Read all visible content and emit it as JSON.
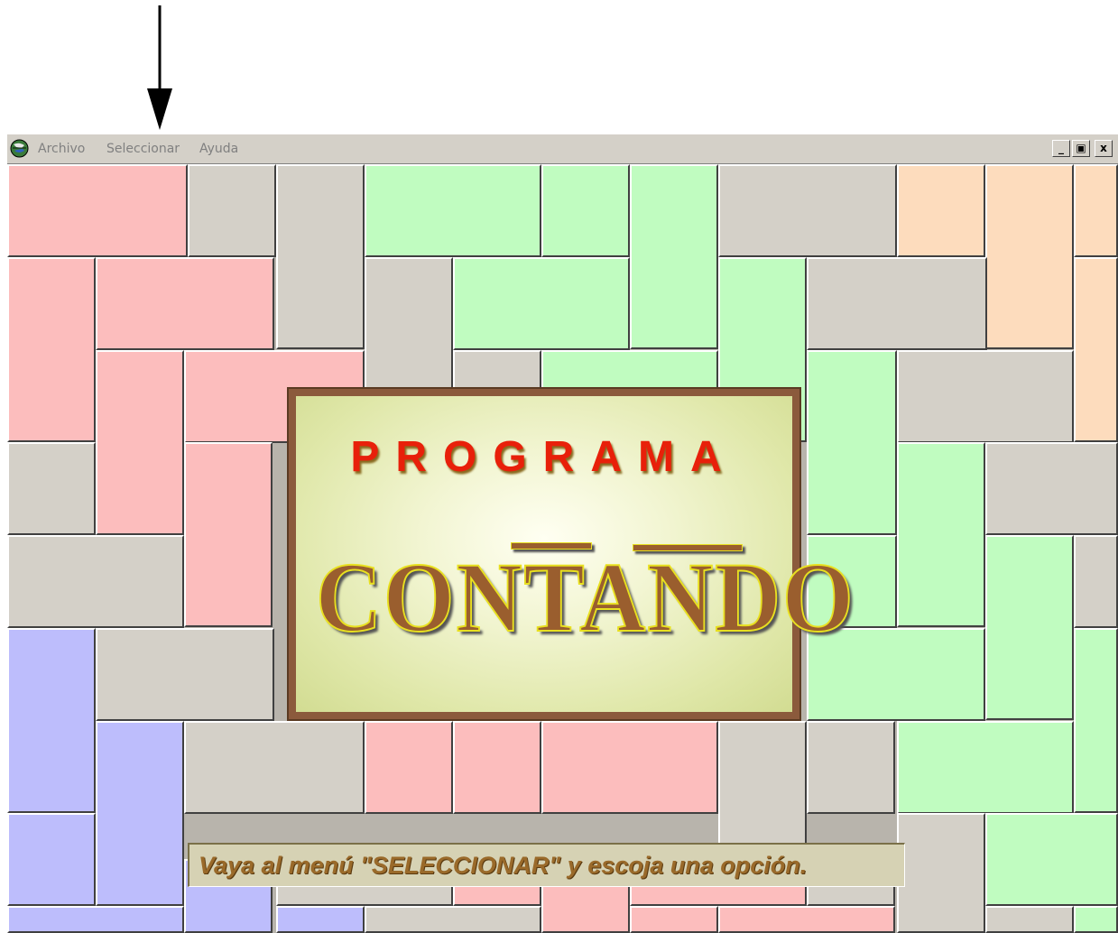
{
  "menu": {
    "items": [
      {
        "label": "Archivo"
      },
      {
        "label": "Seleccionar"
      },
      {
        "label": "Ayuda"
      }
    ]
  },
  "window_controls": {
    "minimize": "_",
    "restore": "▣",
    "close": "x"
  },
  "title_card": {
    "line1": "PROGRAMA",
    "line2": "CONTANDO"
  },
  "status": {
    "message": "Vaya al menú \"SELECCIONAR\" y escoja una opción."
  },
  "colors": {
    "pink": "#fcbdbd",
    "gray": "#d4d0c8",
    "green": "#c0fcc0",
    "peach": "#fddcbd",
    "lavender": "#bdbdfc",
    "title_red": "#e8200a",
    "title_brown": "#9a5e2e"
  },
  "icons": {
    "app": "globe-icon",
    "annotation": "down-arrow-icon"
  }
}
